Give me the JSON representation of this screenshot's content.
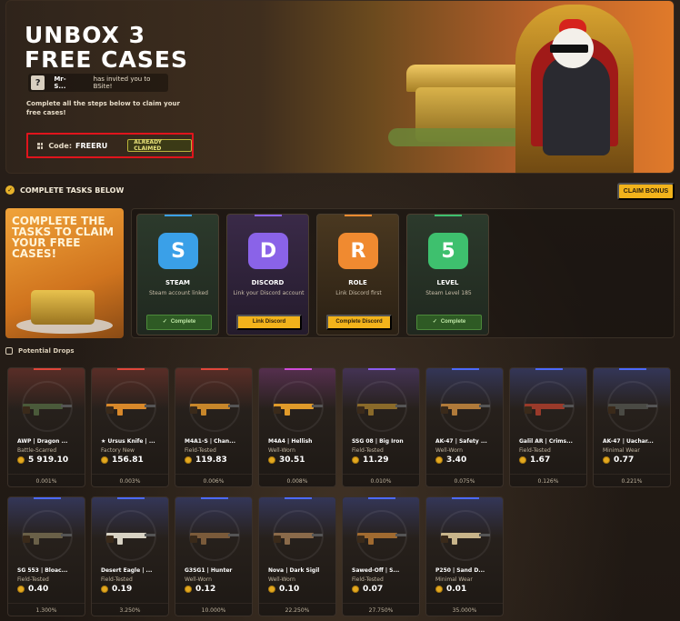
{
  "hero": {
    "title_line1": "UNBOX 3",
    "title_line2": "FREE CASES",
    "inviter_avatar": "?",
    "inviter_name": "Mr-S...",
    "invite_text": "has invited you to BSite!",
    "description": "Complete all the steps below to claim your free cases!",
    "code_label": "Code:",
    "code_value": "FREERU",
    "code_status": "ALREADY CLAIMED"
  },
  "tasks_section": {
    "title": "COMPLETE TASKS BELOW",
    "claim_button": "CLAIM BONUS",
    "promo_text": "COMPLETE THE TASKS TO CLAIM YOUR FREE CASES!",
    "tasks": [
      {
        "name": "STEAM",
        "desc": "Steam account linked",
        "button": "Complete",
        "status": "done",
        "icon": "steam-icon",
        "color": "#3aa0e8"
      },
      {
        "name": "DISCORD",
        "desc": "Link your Discord account",
        "button": "Link Discord",
        "status": "action",
        "icon": "discord-icon",
        "color": "#8a63e8"
      },
      {
        "name": "ROLE",
        "desc": "Link Discord first",
        "button": "Complete Discord",
        "status": "action",
        "icon": "role-icon",
        "color": "#f08a30"
      },
      {
        "name": "LEVEL",
        "desc": "Steam Level 185",
        "button": "Complete",
        "status": "done",
        "icon": "level-icon",
        "color": "#3ec06e"
      }
    ],
    "task_glyphs": [
      "S",
      "D",
      "R",
      "5"
    ]
  },
  "drops": {
    "title": "Potential Drops",
    "items": [
      {
        "name": "AWP | Dragon ...",
        "wear": "Battle-Scarred",
        "price": "5 919.10",
        "odds": "0.001%",
        "rarity": "#e0463a"
      },
      {
        "name": "★ Ursus Knife | ...",
        "wear": "Factory New",
        "price": "156.81",
        "odds": "0.003%",
        "rarity": "#e0463a"
      },
      {
        "name": "M4A1-S | Chan...",
        "wear": "Field-Tested",
        "price": "119.83",
        "odds": "0.006%",
        "rarity": "#e0463a"
      },
      {
        "name": "M4A4 | Hellish",
        "wear": "Well-Worn",
        "price": "30.51",
        "odds": "0.008%",
        "rarity": "#d04bd8"
      },
      {
        "name": "SSG 08 | Big Iron",
        "wear": "Field-Tested",
        "price": "11.29",
        "odds": "0.010%",
        "rarity": "#8a5cf0"
      },
      {
        "name": "AK-47 | Safety ...",
        "wear": "Well-Worn",
        "price": "3.40",
        "odds": "0.075%",
        "rarity": "#4b69ff"
      },
      {
        "name": "Galil AR | Crims...",
        "wear": "Field-Tested",
        "price": "1.67",
        "odds": "0.126%",
        "rarity": "#4b69ff"
      },
      {
        "name": "AK-47 | Uachar...",
        "wear": "Minimal Wear",
        "price": "0.77",
        "odds": "0.221%",
        "rarity": "#4b69ff"
      },
      {
        "name": "SG 553 | Bloac...",
        "wear": "Field-Tested",
        "price": "0.40",
        "odds": "1.300%",
        "rarity": "#4b69ff"
      },
      {
        "name": "Desert Eagle | ...",
        "wear": "Field-Tested",
        "price": "0.19",
        "odds": "3.250%",
        "rarity": "#4b69ff"
      },
      {
        "name": "G3SG1 | Hunter",
        "wear": "Well-Worn",
        "price": "0.12",
        "odds": "10.000%",
        "rarity": "#4b69ff"
      },
      {
        "name": "Nova | Dark Sigil",
        "wear": "Well-Worn",
        "price": "0.10",
        "odds": "22.250%",
        "rarity": "#4b69ff"
      },
      {
        "name": "Sawed-Off | S...",
        "wear": "Field-Tested",
        "price": "0.07",
        "odds": "27.750%",
        "rarity": "#4b69ff"
      },
      {
        "name": "P250 | Sand D...",
        "wear": "Minimal Wear",
        "price": "0.01",
        "odds": "35.000%",
        "rarity": "#4b69ff"
      }
    ]
  }
}
